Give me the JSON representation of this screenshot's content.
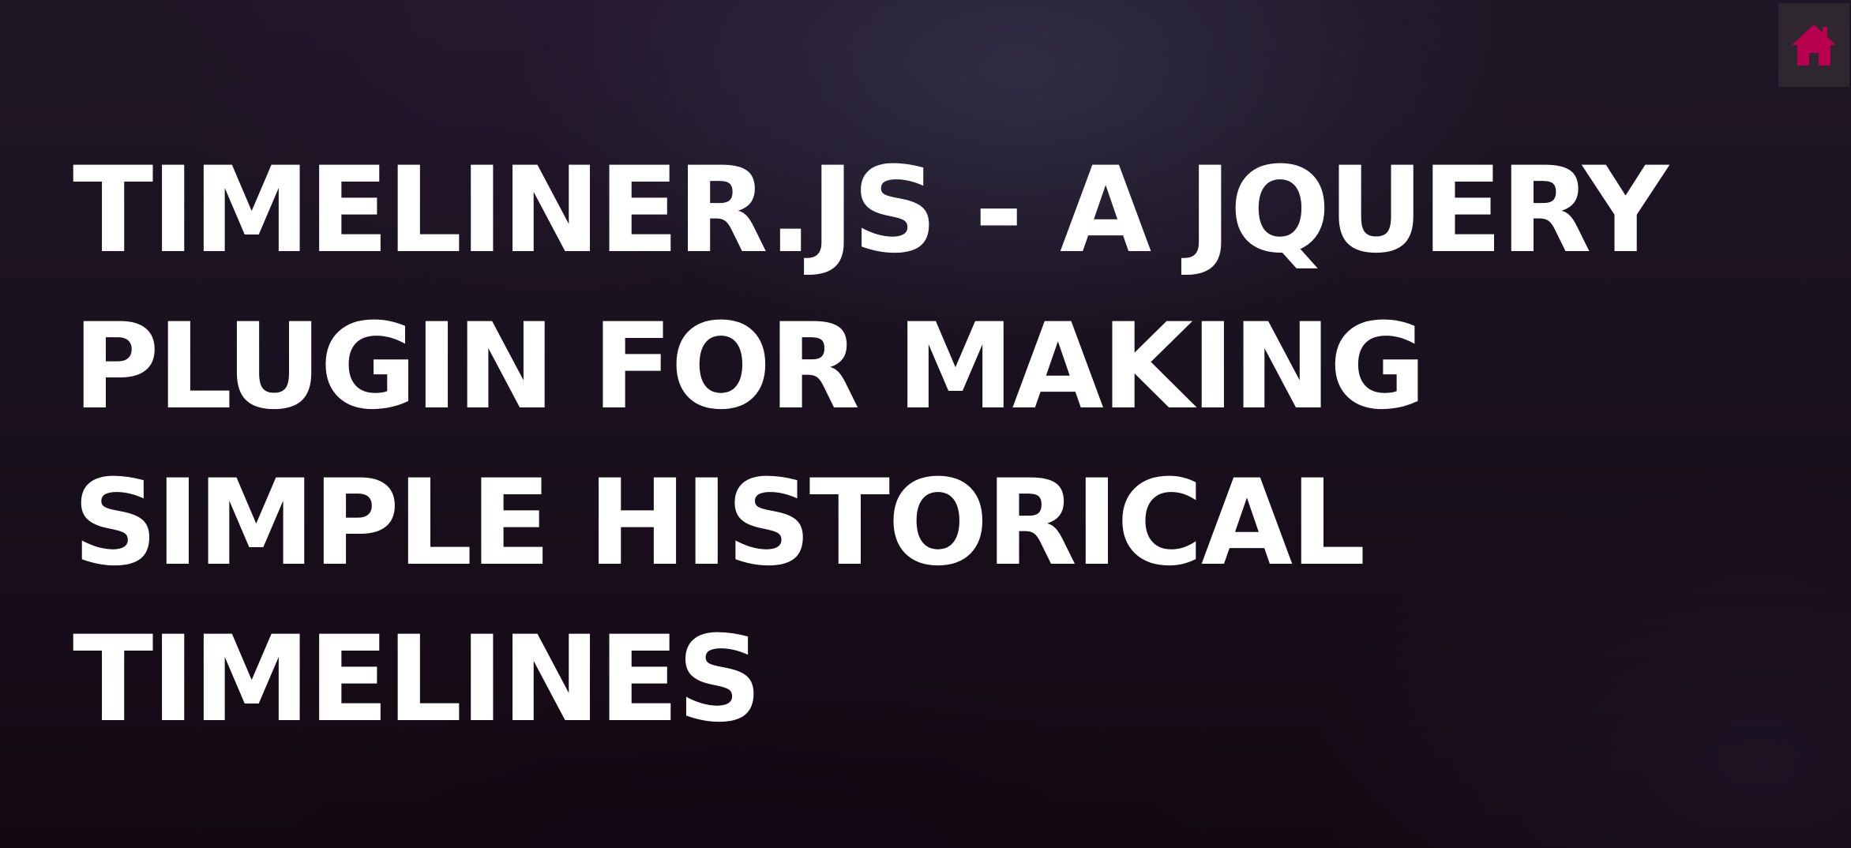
{
  "page": {
    "title_lines": [
      "TIMELINER.JS - A JQUERY",
      "PLUGIN FOR MAKING",
      "SIMPLE HISTORICAL",
      "TIMELINES"
    ]
  },
  "nav": {
    "home_icon": "home-icon",
    "home_button_bg": "#2f2730",
    "home_icon_color": "#b8004f"
  },
  "colors": {
    "title_text": "#ffffff",
    "background": "#1a0f1e"
  }
}
